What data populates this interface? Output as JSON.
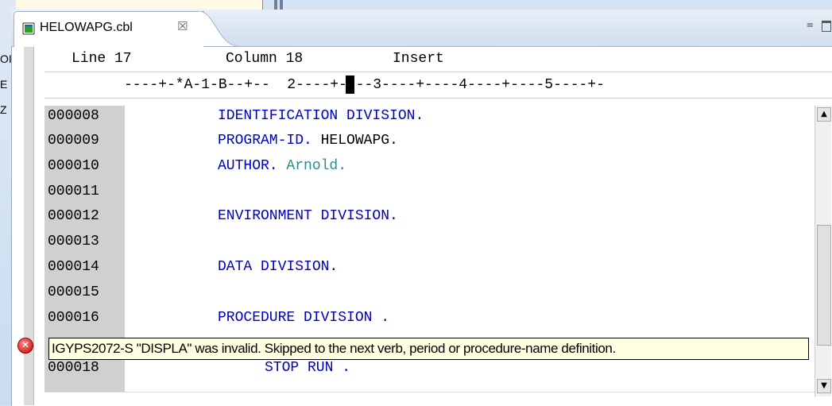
{
  "left_panel": {
    "truncated_labels": [
      "OI",
      "E",
      "Z"
    ]
  },
  "tab": {
    "filename": "HELOWAPG.cbl",
    "close_glyph": "☒",
    "icon": "cobol-file-icon"
  },
  "window_controls": {
    "minimize_glyph": "=",
    "maximize_icon": "maximize-icon"
  },
  "status": {
    "line": "Line 17",
    "column": "Column 18",
    "mode": "Insert"
  },
  "ruler": "----+-*A-1-B--+--  2----+----3----+----4----+----5----+-",
  "lines": [
    {
      "num": "000008",
      "keyword": "IDENTIFICATION DIVISION.",
      "rest": ""
    },
    {
      "num": "000009",
      "keyword": "PROGRAM-ID.",
      "rest": " HELOWAPG."
    },
    {
      "num": "000010",
      "keyword": "AUTHOR.",
      "rest": " Arnold."
    },
    {
      "num": "000011",
      "keyword": "",
      "rest": ""
    },
    {
      "num": "000012",
      "keyword": "ENVIRONMENT DIVISION.",
      "rest": ""
    },
    {
      "num": "000013",
      "keyword": "",
      "rest": ""
    },
    {
      "num": "000014",
      "keyword": "DATA DIVISION.",
      "rest": ""
    },
    {
      "num": "000015",
      "keyword": "",
      "rest": ""
    },
    {
      "num": "000016",
      "keyword": "PROCEDURE DIVISION .",
      "rest": ""
    },
    {
      "num": "000018",
      "keyword": "STOP RUN .",
      "rest": ""
    }
  ],
  "error": {
    "icon": "error-icon",
    "message": "IGYPS2072-S \"DISPLA\" was invalid.  Skipped to the next verb, period or procedure-name definition."
  },
  "colors": {
    "keyword": "#0000c0",
    "comment_teal": "#2a8c8c",
    "tooltip_bg": "#ffffe1",
    "gutter": "#d0d0d0"
  }
}
